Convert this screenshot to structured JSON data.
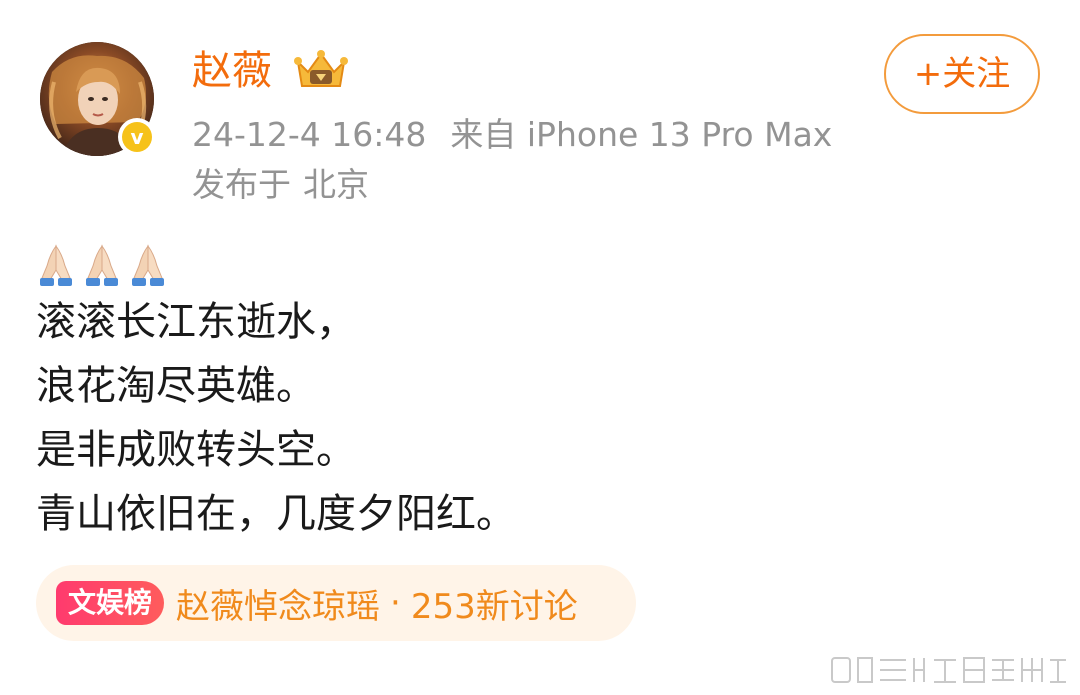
{
  "author": {
    "name": "赵薇",
    "verified_mark": "v"
  },
  "meta": {
    "timestamp": "24-12-4 16:48",
    "source_prefix": "来自",
    "device": "iPhone 13 Pro Max",
    "location_prefix": "发布于",
    "location": "北京"
  },
  "follow_button": {
    "label": "+关注"
  },
  "post": {
    "emoji": [
      "pray-icon",
      "pray-icon",
      "pray-icon"
    ],
    "lines": [
      "滚滚长江东逝水，",
      "浪花淘尽英雄。",
      "是非成败转头空。",
      "青山依旧在，几度夕阳红。"
    ]
  },
  "hot_topic": {
    "tag": "文娱榜",
    "title": "赵薇悼念琼瑶",
    "separator": "·",
    "discussion": "253新讨论"
  },
  "colors": {
    "brand_orange": "#f36c0c",
    "meta_gray": "#939393",
    "topic_bg": "#fff4e8",
    "tag_red": "#ff3a6e",
    "verified_yellow": "#f6c21a"
  }
}
